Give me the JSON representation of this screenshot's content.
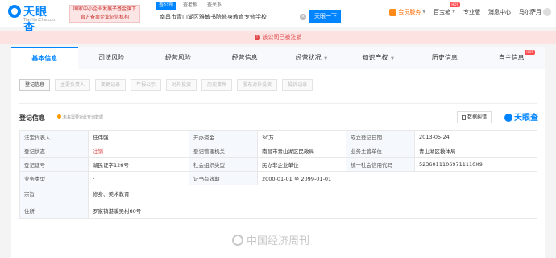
{
  "header": {
    "logo_text": "天眼查",
    "logo_sub": "TianYanCha.com",
    "banner_line1": "国家中小企业发展子基金旗下",
    "banner_line2": "官方备案企业征信机构",
    "search_tabs": [
      "查公司",
      "查老板",
      "查关系"
    ],
    "search_value": "南昌市青山湖区雅敏书院修身教育专修学校",
    "search_button": "天眼一下",
    "nav": {
      "vip": "会员服务",
      "box": "百宝箱",
      "hot_badge": "HOT",
      "pro": "专业版",
      "messages": "消息中心",
      "user": "马尔萨月"
    }
  },
  "alert": {
    "text": "该公司已被注销"
  },
  "tabs": [
    "基本信息",
    "司法风险",
    "经营风险",
    "经营信息",
    "经营状况",
    "知识产权",
    "历史信息",
    "自主信息"
  ],
  "tab_hot": "HOT",
  "subtabs": [
    "登记信息",
    "主要负责人",
    "变更记录",
    "年报公示",
    "对外投资",
    "历史事件",
    "股东对外投资",
    "投诉记录"
  ],
  "section": {
    "title": "登记信息",
    "note": "未来需要对此查询数据",
    "feedback": "数据纠错",
    "brand": "天眼查"
  },
  "info_table": {
    "rows": [
      [
        "法定代表人",
        "任伟强",
        "开办资金",
        "30万",
        "成立登记日期",
        "2013-05-24"
      ],
      [
        "登记状态",
        "注销",
        "登记管理机关",
        "南昌市青山湖区民政局",
        "业务主管单位",
        "青山湖区教体局"
      ],
      [
        "登记证号",
        "湖民证字126号",
        "社会组织类型",
        "民办非企业单位",
        "统一社会信用代码",
        "52360111069711110X9"
      ],
      [
        "业务类型",
        "-",
        "证书有效期",
        "2000-01-01 至 2099-01-01"
      ],
      [
        "宗旨",
        "修身、美术教育"
      ],
      [
        "住所",
        "罗家镇港溪吴村60号"
      ]
    ]
  },
  "watermark": "中国经济周刊",
  "colors": {
    "accent": "#0084ff",
    "alert": "#e04a4a",
    "vip": "#ff6a00"
  }
}
